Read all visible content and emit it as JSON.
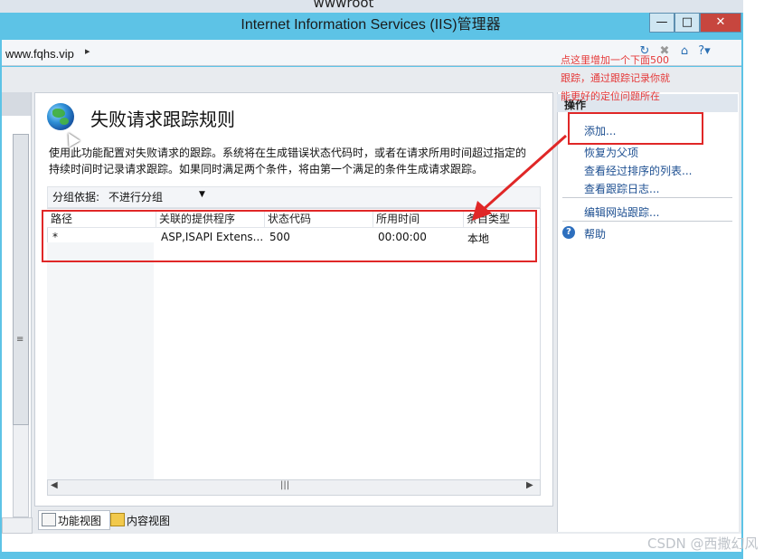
{
  "background_window": {
    "title": "wwwroot"
  },
  "window": {
    "title": "Internet Information Services (IIS)管理器",
    "minimize": "—",
    "maximize": "□",
    "close": "✕"
  },
  "address_bar": {
    "path": "www.fqhs.vip",
    "separator": "▸",
    "icons": [
      "refresh-icon",
      "stop-icon",
      "home-icon",
      "help-icon"
    ]
  },
  "page": {
    "title": "失败请求跟踪规则",
    "description_line1": "使用此功能配置对失败请求的跟踪。系统将在生成错误状态代码时，或者在请求所用时间超过指定的",
    "description_line2": "持续时间时记录请求跟踪。如果同时满足两个条件，将由第一个满足的条件生成请求跟踪。",
    "group_by_label": "分组依据:",
    "group_by_value": "不进行分组",
    "columns": [
      "路径",
      "关联的提供程序",
      "状态代码",
      "所用时间",
      "条目类型"
    ],
    "rows": [
      {
        "path": "*",
        "providers": "ASP,ISAPI Extens...",
        "status": "500",
        "time": "00:00:00",
        "entry_type": "本地"
      }
    ]
  },
  "annotation": {
    "line1": "点这里增加一个下面500",
    "line2": "跟踪，通过跟踪记录你就",
    "line3": "能更好的定位问题所在",
    "color": "#e02727"
  },
  "actions": {
    "header": "操作",
    "items": [
      {
        "label": "添加..."
      },
      {
        "label": "恢复为父项"
      },
      {
        "label": "查看经过排序的列表..."
      },
      {
        "label": "查看跟踪日志..."
      },
      {
        "label": "编辑网站跟踪..."
      },
      {
        "label": "帮助"
      }
    ]
  },
  "view_tabs": {
    "feature_view": "功能视图",
    "content_view": "内容视图"
  },
  "watermark": "CSDN @西撒幻风"
}
